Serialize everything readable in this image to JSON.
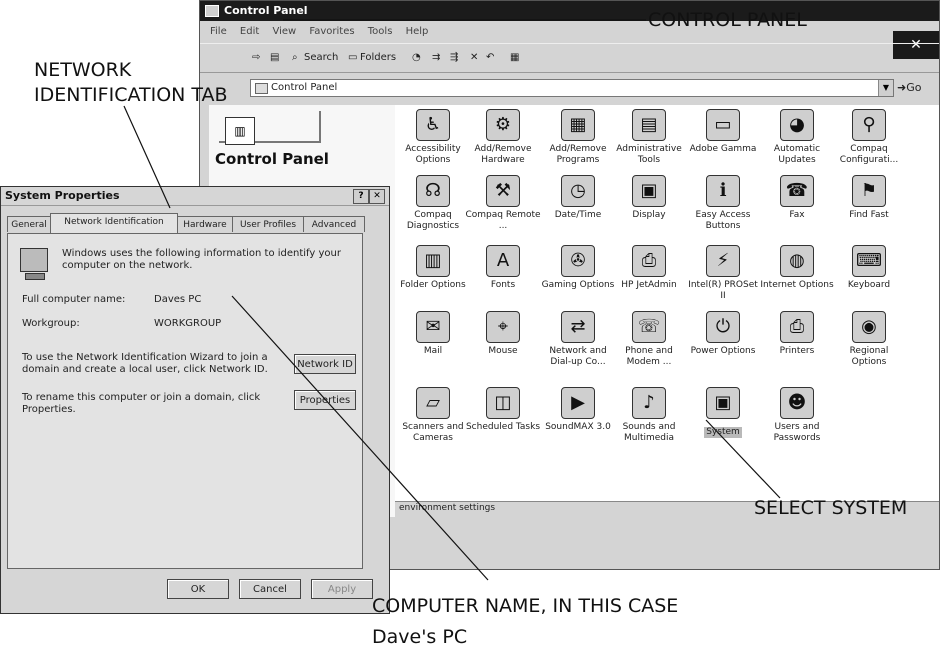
{
  "labels": {
    "control_panel": "CONTROL PANEL",
    "network_tab_line1": "NETWORK",
    "network_tab_line2": "IDENTIFICATION TAB",
    "select_system": "SELECT SYSTEM",
    "computer_name_line1": "COMPUTER NAME, IN THIS CASE",
    "computer_name_line2": "Dave's PC"
  },
  "control_panel_window": {
    "title": "Control Panel",
    "close_glyph": "✕",
    "menu": [
      "File",
      "Edit",
      "View",
      "Favorites",
      "Tools",
      "Help"
    ],
    "toolbar": {
      "search": "Search",
      "folders": "Folders"
    },
    "address": "Control Panel",
    "go": "Go",
    "left_title": "Control Panel",
    "status_text": "environment settings",
    "items": [
      {
        "label": "Accessibility Options",
        "icon": "accessibility-icon",
        "glyph": "♿"
      },
      {
        "label": "Add/Remove Hardware",
        "icon": "add-remove-hardware-icon",
        "glyph": "⚙"
      },
      {
        "label": "Add/Remove Programs",
        "icon": "add-remove-programs-icon",
        "glyph": "▦"
      },
      {
        "label": "Administrative Tools",
        "icon": "administrative-tools-icon",
        "glyph": "▤"
      },
      {
        "label": "Adobe Gamma",
        "icon": "adobe-gamma-icon",
        "glyph": "▭"
      },
      {
        "label": "Automatic Updates",
        "icon": "automatic-updates-icon",
        "glyph": "◕"
      },
      {
        "label": "Compaq Configurati...",
        "icon": "compaq-configuration-icon",
        "glyph": "⚲"
      },
      {
        "label": "Compaq Diagnostics",
        "icon": "compaq-diagnostics-icon",
        "glyph": "☊"
      },
      {
        "label": "Compaq Remote ...",
        "icon": "compaq-remote-icon",
        "glyph": "⚒"
      },
      {
        "label": "Date/Time",
        "icon": "date-time-icon",
        "glyph": "◷"
      },
      {
        "label": "Display",
        "icon": "display-icon",
        "glyph": "▣"
      },
      {
        "label": "Easy Access Buttons",
        "icon": "easy-access-buttons-icon",
        "glyph": "ℹ"
      },
      {
        "label": "Fax",
        "icon": "fax-icon",
        "glyph": "☎"
      },
      {
        "label": "Find Fast",
        "icon": "find-fast-icon",
        "glyph": "⚑"
      },
      {
        "label": "Folder Options",
        "icon": "folder-options-icon",
        "glyph": "▥"
      },
      {
        "label": "Fonts",
        "icon": "fonts-icon",
        "glyph": "A"
      },
      {
        "label": "Gaming Options",
        "icon": "gaming-options-icon",
        "glyph": "✇"
      },
      {
        "label": "HP JetAdmin",
        "icon": "hp-jetadmin-icon",
        "glyph": "⎙"
      },
      {
        "label": "Intel(R) PROSet II",
        "icon": "intel-proset-icon",
        "glyph": "⚡"
      },
      {
        "label": "Internet Options",
        "icon": "internet-options-icon",
        "glyph": "◍"
      },
      {
        "label": "Keyboard",
        "icon": "keyboard-icon",
        "glyph": "⌨"
      },
      {
        "label": "Mail",
        "icon": "mail-icon",
        "glyph": "✉"
      },
      {
        "label": "Mouse",
        "icon": "mouse-icon",
        "glyph": "⌖"
      },
      {
        "label": "Network and Dial-up Co...",
        "icon": "network-dialup-icon",
        "glyph": "⇄"
      },
      {
        "label": "Phone and Modem ...",
        "icon": "phone-modem-icon",
        "glyph": "☏"
      },
      {
        "label": "Power Options",
        "icon": "power-options-icon",
        "glyph": "⏻"
      },
      {
        "label": "Printers",
        "icon": "printers-icon",
        "glyph": "⎙"
      },
      {
        "label": "Regional Options",
        "icon": "regional-options-icon",
        "glyph": "◉"
      },
      {
        "label": "Scanners and Cameras",
        "icon": "scanners-cameras-icon",
        "glyph": "▱"
      },
      {
        "label": "Scheduled Tasks",
        "icon": "scheduled-tasks-icon",
        "glyph": "◫"
      },
      {
        "label": "SoundMAX 3.0",
        "icon": "soundmax-icon",
        "glyph": "▶"
      },
      {
        "label": "Sounds and Multimedia",
        "icon": "sounds-multimedia-icon",
        "glyph": "♪"
      },
      {
        "label": "System",
        "icon": "system-icon",
        "glyph": "▣"
      },
      {
        "label": "Users and Passwords",
        "icon": "users-passwords-icon",
        "glyph": "☻"
      }
    ]
  },
  "system_properties": {
    "title": "System Properties",
    "help_glyph": "?",
    "close_glyph": "✕",
    "tabs": [
      "General",
      "Network Identification",
      "Hardware",
      "User Profiles",
      "Advanced"
    ],
    "active_tab": "Network Identification",
    "intro": "Windows uses the following information to identify your computer on the network.",
    "full_name_label": "Full computer name:",
    "full_name_value": "Daves PC",
    "workgroup_label": "Workgroup:",
    "workgroup_value": "WORKGROUP",
    "network_id_text": "To use the Network Identification Wizard to join a domain and create a local user, click Network ID.",
    "network_id_button": "Network ID",
    "rename_text": "To rename this computer or join a domain, click Properties.",
    "properties_button": "Properties",
    "ok_button": "OK",
    "cancel_button": "Cancel",
    "apply_button": "Apply"
  }
}
